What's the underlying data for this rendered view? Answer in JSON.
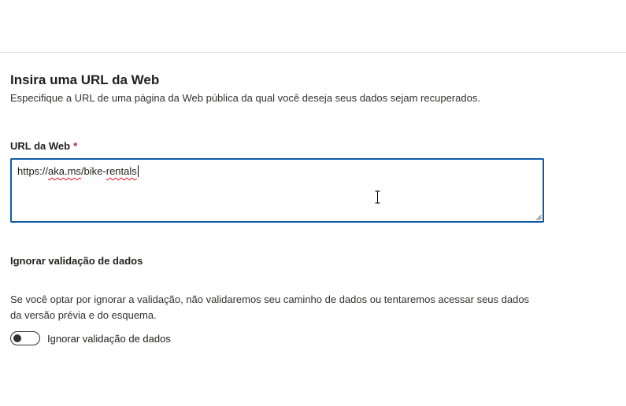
{
  "header": {
    "title": "Insira uma URL da Web",
    "description": "Especifique a URL de uma página da Web pública da qual você deseja seus dados sejam recuperados."
  },
  "url_field": {
    "label": "URL da Web",
    "required_mark": "*",
    "value_parts": [
      "https://",
      "aka.ms",
      "/bike-",
      "rentals"
    ]
  },
  "validation": {
    "title": "Ignorar validação de dados",
    "description": "Se você optar por ignorar a validação, não validaremos seu caminho de dados ou tentaremos acessar seus dados da versão prévia e do esquema.",
    "toggle_label": "Ignorar validação de dados",
    "toggle_on": false
  },
  "icons": {
    "resize": "resize-grip-icon",
    "cursor": "text-cursor-icon"
  },
  "colors": {
    "focus_border": "#0f5ba9",
    "required": "#a4262c",
    "spellcheck": "#e81123"
  }
}
